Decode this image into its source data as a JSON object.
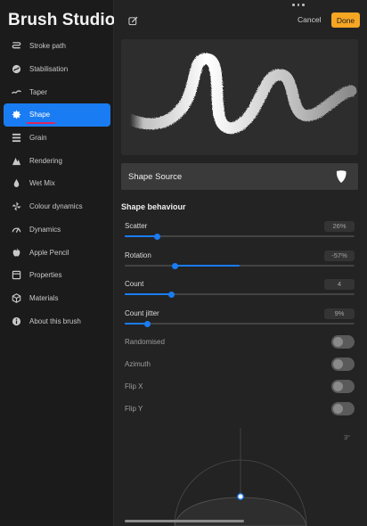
{
  "sidebar": {
    "title": "Brush Studio",
    "items": [
      {
        "label": "Stroke path",
        "icon": "stroke-path-icon"
      },
      {
        "label": "Stabilisation",
        "icon": "stabilisation-icon"
      },
      {
        "label": "Taper",
        "icon": "taper-icon"
      },
      {
        "label": "Shape",
        "icon": "shape-icon",
        "active": true
      },
      {
        "label": "Grain",
        "icon": "grain-icon"
      },
      {
        "label": "Rendering",
        "icon": "rendering-icon"
      },
      {
        "label": "Wet Mix",
        "icon": "wet-mix-icon"
      },
      {
        "label": "Colour dynamics",
        "icon": "colour-dynamics-icon"
      },
      {
        "label": "Dynamics",
        "icon": "dynamics-icon"
      },
      {
        "label": "Apple Pencil",
        "icon": "apple-pencil-icon"
      },
      {
        "label": "Properties",
        "icon": "properties-icon"
      },
      {
        "label": "Materials",
        "icon": "materials-icon"
      },
      {
        "label": "About this brush",
        "icon": "info-icon"
      }
    ]
  },
  "header": {
    "cancel_label": "Cancel",
    "done_label": "Done"
  },
  "shape_source": {
    "label": "Shape Source"
  },
  "shape_behaviour": {
    "title": "Shape behaviour",
    "params": [
      {
        "label": "Scatter",
        "value": "26%",
        "fraction": 0.14
      },
      {
        "label": "Rotation",
        "value": "-57%",
        "fraction": 0.22,
        "centered": true
      },
      {
        "label": "Count",
        "value": "4",
        "fraction": 0.205
      },
      {
        "label": "Count jitter",
        "value": "9%",
        "fraction": 0.1
      }
    ],
    "toggles": [
      {
        "label": "Randomised",
        "on": false
      },
      {
        "label": "Azimuth",
        "on": false
      },
      {
        "label": "Flip X",
        "on": false
      },
      {
        "label": "Flip Y",
        "on": false
      }
    ]
  },
  "roundness": {
    "angle_label": "3°"
  },
  "colors": {
    "accent": "#1a7cf2",
    "done": "#f5a623",
    "background": "#232324"
  }
}
